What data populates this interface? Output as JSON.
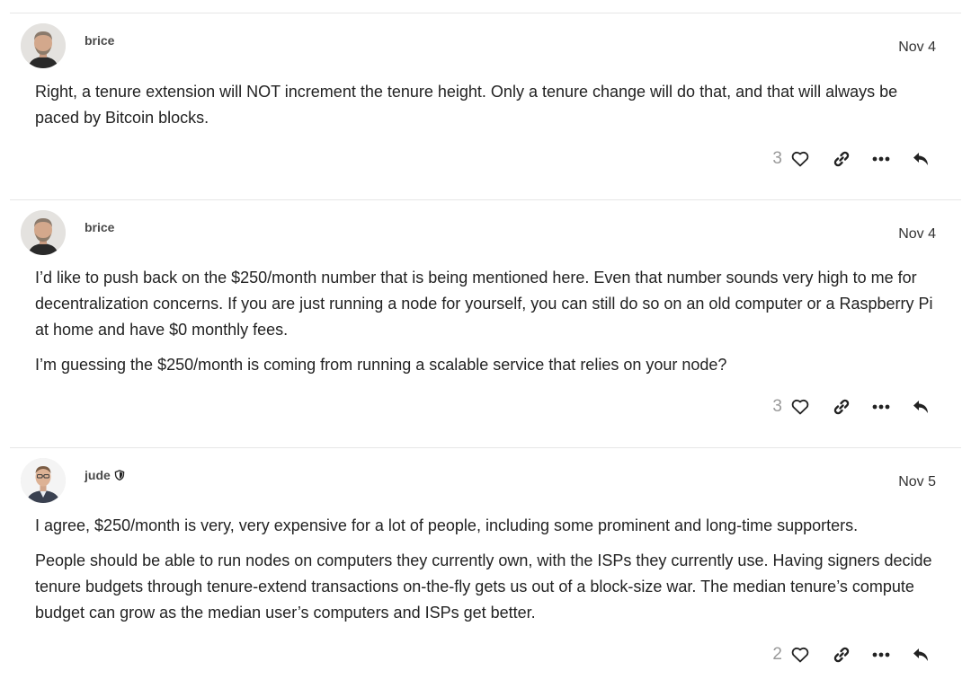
{
  "posts": [
    {
      "username": "brice",
      "date": "Nov 4",
      "paragraphs": [
        "Right, a tenure extension will NOT increment the tenure height. Only a tenure change will do that, and that will always be paced by Bitcoin blocks."
      ],
      "likes": "3"
    },
    {
      "username": "brice",
      "date": "Nov 4",
      "paragraphs": [
        "I’d like to push back on the $250/month number that is being mentioned here. Even that number sounds very high to me for decentralization concerns. If you are just running a node for yourself, you can still do so on an old computer or a Raspberry Pi at home and have $0 monthly fees.",
        "I’m guessing the $250/month is coming from running a scalable service that relies on your node?"
      ],
      "likes": "3"
    },
    {
      "username": "jude",
      "date": "Nov 5",
      "paragraphs": [
        "I agree, $250/month is very, very expensive for a lot of people, including some prominent and long-time supporters.",
        "People should be able to run nodes on computers they currently own, with the ISPs they currently use. Having signers decide tenure budgets through tenure-extend transactions on-the-fly gets us out of a block-size war. The median tenure’s compute budget can grow as the median user’s computers and ISPs get better."
      ],
      "likes": "2"
    }
  ],
  "icons": {
    "like": "heart-icon",
    "share": "link-icon",
    "more": "ellipsis-icon",
    "reply": "reply-icon",
    "badge": "shield-icon"
  },
  "colors": {
    "text": "#222222",
    "muted": "#999999",
    "divider": "#e6e6e6"
  }
}
